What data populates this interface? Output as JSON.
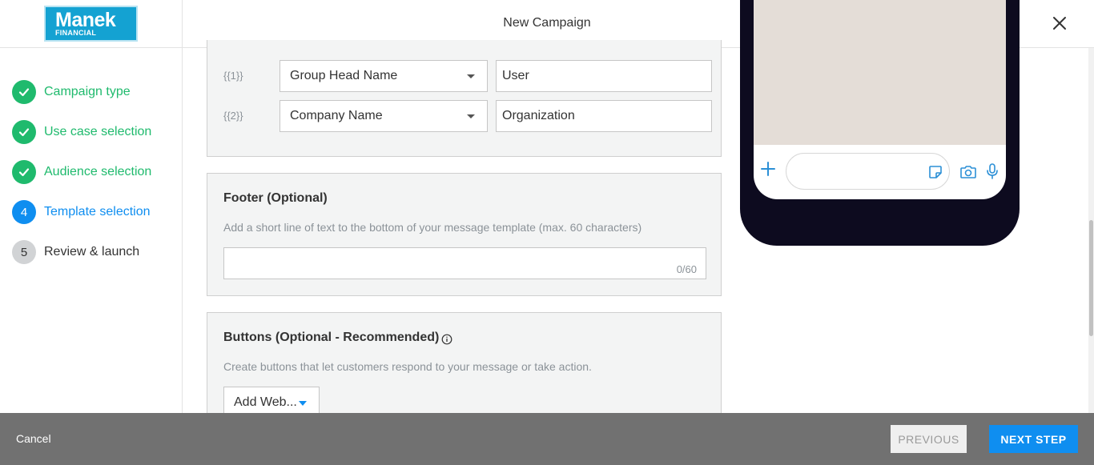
{
  "brand": {
    "name": "Manek",
    "sub": "FINANCIAL",
    "color": "#14a2d2"
  },
  "header": {
    "title": "New Campaign",
    "close_icon": "close-icon"
  },
  "steps": [
    {
      "number": "1",
      "label": "Campaign type",
      "state": "done"
    },
    {
      "number": "2",
      "label": "Use case selection",
      "state": "done"
    },
    {
      "number": "3",
      "label": "Audience selection",
      "state": "done"
    },
    {
      "number": "4",
      "label": "Template selection",
      "state": "active"
    },
    {
      "number": "5",
      "label": "Review & launch",
      "state": "pending"
    }
  ],
  "variables": [
    {
      "key": "{{1}}",
      "field": "Group Head Name",
      "fallback": "User"
    },
    {
      "key": "{{2}}",
      "field": "Company Name",
      "fallback": "Organization"
    }
  ],
  "footer_section": {
    "title": "Footer (Optional)",
    "description": "Add a short line of text to the bottom of your message template (max. 60 characters)",
    "value": "",
    "counter": "0/60"
  },
  "buttons_section": {
    "title": "Buttons (Optional - Recommended)",
    "description": "Create buttons that let customers respond to your message or take action.",
    "add_label": "Add Web..."
  },
  "bottom_bar": {
    "cancel": "Cancel",
    "previous": "PREVIOUS",
    "next": "NEXT STEP"
  },
  "colors": {
    "success": "#1fba6d",
    "active": "#0f8ef0",
    "pending": "#d1d3d5",
    "phone_frame": "#0d0b1f"
  }
}
